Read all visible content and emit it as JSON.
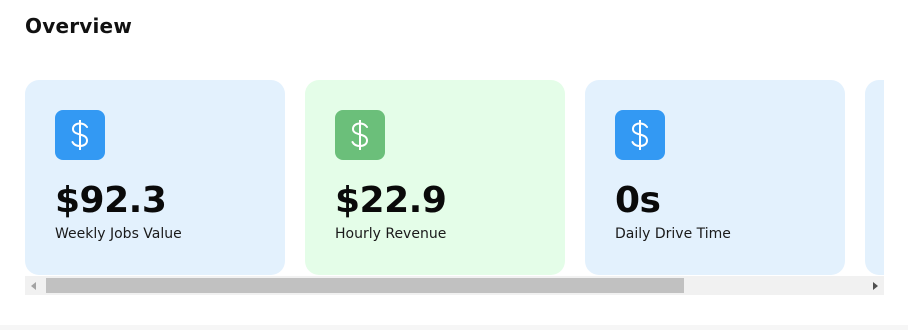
{
  "header": {
    "title": "Overview"
  },
  "cards": [
    {
      "icon": "dollar-icon",
      "value": "$92.3",
      "label": "Weekly Jobs Value",
      "theme": "blue",
      "bg_color": "#e3f1fd",
      "icon_color": "#3399f3"
    },
    {
      "icon": "dollar-icon",
      "value": "$22.9",
      "label": "Hourly Revenue",
      "theme": "green",
      "bg_color": "#e4fde8",
      "icon_color": "#6bbf7a"
    },
    {
      "icon": "dollar-icon",
      "value": "0s",
      "label": "Daily Drive Time",
      "theme": "blue",
      "bg_color": "#e3f1fd",
      "icon_color": "#3399f3"
    },
    {
      "icon": "",
      "value": "",
      "label": "",
      "theme": "blue",
      "bg_color": "#e3f1fd",
      "icon_color": "#3399f3"
    }
  ],
  "scrollbar": {
    "left_icon": "triangle-left-icon",
    "right_icon": "triangle-right-icon"
  }
}
